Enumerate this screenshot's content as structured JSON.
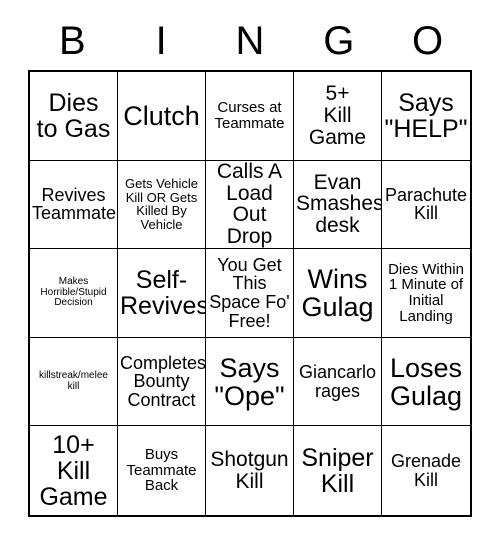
{
  "card": {
    "title": "BINGO",
    "headers": [
      "B",
      "I",
      "N",
      "G",
      "O"
    ],
    "columns": 5,
    "rows": 5,
    "free_space_index": 12,
    "colors": {
      "background": "#ffffff",
      "text": "#000000",
      "grid_line": "#000000"
    },
    "cells": [
      {
        "text": "Dies\nto Gas",
        "size": "xl"
      },
      {
        "text": "Clutch",
        "size": "xxl"
      },
      {
        "text": "Curses at\nTeammate",
        "size": "sm"
      },
      {
        "text": "5+\nKill\nGame",
        "size": "lg"
      },
      {
        "text": "Says\n\"HELP\"",
        "size": "xl"
      },
      {
        "text": "Revives\nTeammate",
        "size": "md"
      },
      {
        "text": "Gets Vehicle\nKill OR Gets\nKilled By\nVehicle",
        "size": "xs"
      },
      {
        "text": "Calls A\nLoad\nOut Drop",
        "size": "lg"
      },
      {
        "text": "Evan\nSmashes\ndesk",
        "size": "lg"
      },
      {
        "text": "Parachute\nKill",
        "size": "md"
      },
      {
        "text": "Makes\nHorrible/Stupid\nDecision",
        "size": "xxs"
      },
      {
        "text": "Self-\nRevives",
        "size": "xl"
      },
      {
        "text": "You Get\nThis\nSpace Fo'\nFree!",
        "size": "md"
      },
      {
        "text": "Wins\nGulag",
        "size": "xxl"
      },
      {
        "text": "Dies Within\n1 Minute of\nInitial\nLanding",
        "size": "sm"
      },
      {
        "text": "killstreak/melee\nkill",
        "size": "xxs"
      },
      {
        "text": "Completes\nBounty\nContract",
        "size": "md"
      },
      {
        "text": "Says\n\"Ope\"",
        "size": "xxl"
      },
      {
        "text": "Giancarlo\nrages",
        "size": "md"
      },
      {
        "text": "Loses\nGulag",
        "size": "xxl"
      },
      {
        "text": "10+\nKill\nGame",
        "size": "xl"
      },
      {
        "text": "Buys\nTeammate\nBack",
        "size": "sm"
      },
      {
        "text": "Shotgun\nKill",
        "size": "lg"
      },
      {
        "text": "Sniper\nKill",
        "size": "xl"
      },
      {
        "text": "Grenade\nKill",
        "size": "md"
      }
    ]
  }
}
